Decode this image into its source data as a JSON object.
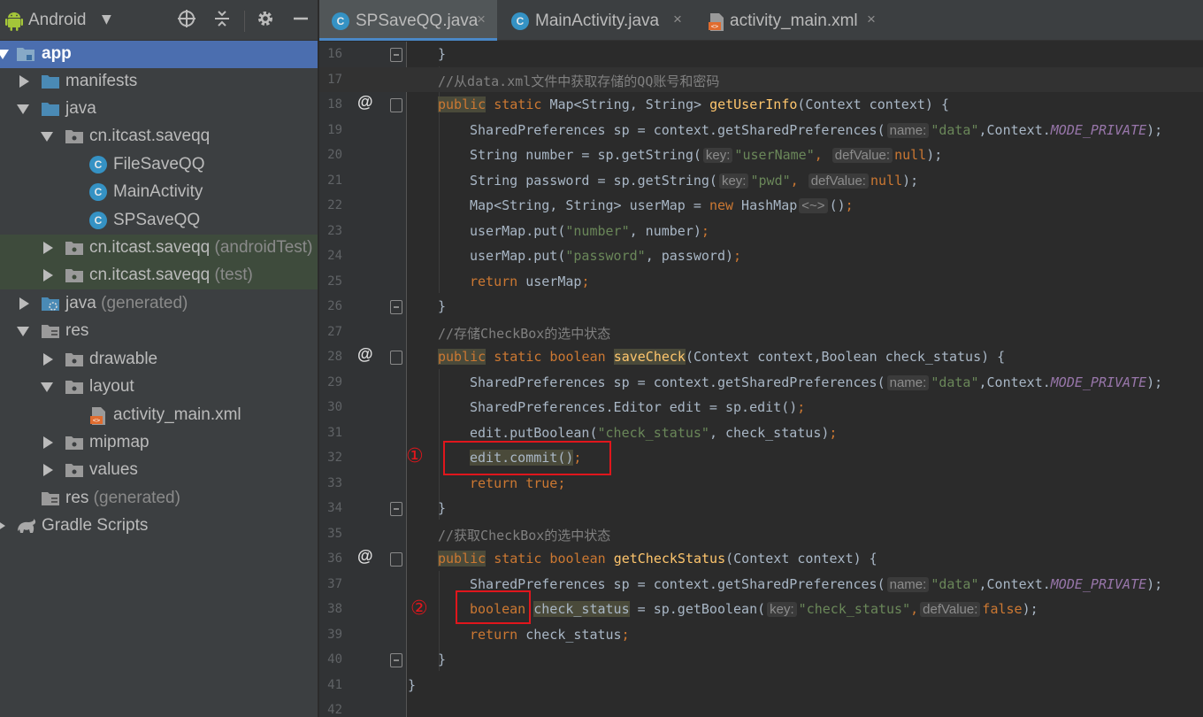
{
  "project_panel": {
    "view_selector": "Android",
    "tree": [
      {
        "label": "app",
        "suffix": "",
        "icon": "module-folder-icon"
      },
      {
        "label": "manifests",
        "suffix": "",
        "icon": "folder-icon"
      },
      {
        "label": "java",
        "suffix": "",
        "icon": "folder-icon"
      },
      {
        "label": "cn.itcast.saveqq",
        "suffix": "",
        "icon": "package-icon"
      },
      {
        "label": "FileSaveQQ",
        "suffix": "",
        "icon": "class-icon"
      },
      {
        "label": "MainActivity",
        "suffix": "",
        "icon": "class-icon"
      },
      {
        "label": "SPSaveQQ",
        "suffix": "",
        "icon": "class-icon"
      },
      {
        "label": "cn.itcast.saveqq",
        "suffix": " (androidTest)",
        "icon": "package-icon"
      },
      {
        "label": "cn.itcast.saveqq",
        "suffix": " (test)",
        "icon": "package-icon"
      },
      {
        "label": "java",
        "suffix": " (generated)",
        "icon": "generated-folder-icon"
      },
      {
        "label": "res",
        "suffix": "",
        "icon": "res-folder-icon"
      },
      {
        "label": "drawable",
        "suffix": "",
        "icon": "package-icon"
      },
      {
        "label": "layout",
        "suffix": "",
        "icon": "package-icon"
      },
      {
        "label": "activity_main.xml",
        "suffix": "",
        "icon": "xml-file-icon"
      },
      {
        "label": "mipmap",
        "suffix": "",
        "icon": "package-icon"
      },
      {
        "label": "values",
        "suffix": "",
        "icon": "package-icon"
      },
      {
        "label": "res",
        "suffix": " (generated)",
        "icon": "res-folder-icon"
      },
      {
        "label": "Gradle Scripts",
        "suffix": "",
        "icon": "gradle-icon"
      }
    ]
  },
  "tabs": [
    {
      "label": "SPSaveQQ.java",
      "icon": "class-icon",
      "close": "×"
    },
    {
      "label": "MainActivity.java",
      "icon": "class-icon",
      "close": "×"
    },
    {
      "label": "activity_main.xml",
      "icon": "xml-file-icon",
      "close": "×"
    }
  ],
  "editor": {
    "line_numbers": [
      "16",
      "17",
      "18",
      "19",
      "20",
      "21",
      "22",
      "23",
      "24",
      "25",
      "26",
      "27",
      "28",
      "29",
      "30",
      "31",
      "32",
      "33",
      "34",
      "35",
      "36",
      "37",
      "38",
      "39",
      "40",
      "41",
      "42"
    ],
    "t": {
      "l16": "}",
      "l17": "//从data.xml文件中获取存储的QQ账号和密码",
      "l18_kw1": "public",
      "l18_kw2": " static ",
      "l18_type": "Map<String, String> ",
      "l18_fn": "getUserInfo",
      "l18_rest": "(Context context) {",
      "sp_decl": "SharedPreferences sp = context.getSharedPreferences(",
      "hint_name": "name:",
      "str_data": "\"data\"",
      "ctx_comma": ",Context.",
      "mode_private": "MODE_PRIVATE",
      "close_semi": ");",
      "l20_a": "String number = sp.getString(",
      "hint_key": "key:",
      "str_username": "\"userName\"",
      "comma": ",",
      "hint_def": "defValue:",
      "kw_null": "null",
      "l21_a": "String password = sp.getString(",
      "str_pwd": "\"pwd\"",
      "l22_a": "Map<String, String> userMap = ",
      "kw_new": "new",
      "l22_b": " HashMap",
      "l22_diamond": "<~>",
      "l22_c": "()",
      "semi": ";",
      "l23_a": "userMap.put(",
      "str_number": "\"number\"",
      "l23_b": ", number)",
      "str_password": "\"password\"",
      "l24_b": ", password)",
      "kw_return": "return",
      "l25_b": " userMap",
      "l27": "//存储CheckBox的选中状态",
      "kw_static_boolean": " static boolean ",
      "fn_savecheck": "saveCheck",
      "l28_rest": "(Context context,Boolean check_status) {",
      "l30_a": "SharedPreferences.Editor edit = sp.edit()",
      "l31_a": "edit.putBoolean(",
      "str_check_status": "\"check_status\"",
      "l31_b": ", check_status)",
      "l32_a": "edit.commit()",
      "kw_true": " true",
      "l35": "//获取CheckBox的选中状态",
      "fn_getcheck": "getCheckStatus",
      "l36_rest": "(Context context) {",
      "kw_boolean": "boolean",
      "var_check_status": "check_status",
      "l38_b": " = sp.getBoolean(",
      "kw_false": "false",
      "l39_b": " check_status",
      "l41": "}",
      "marker1": "①",
      "marker2": "②"
    }
  }
}
